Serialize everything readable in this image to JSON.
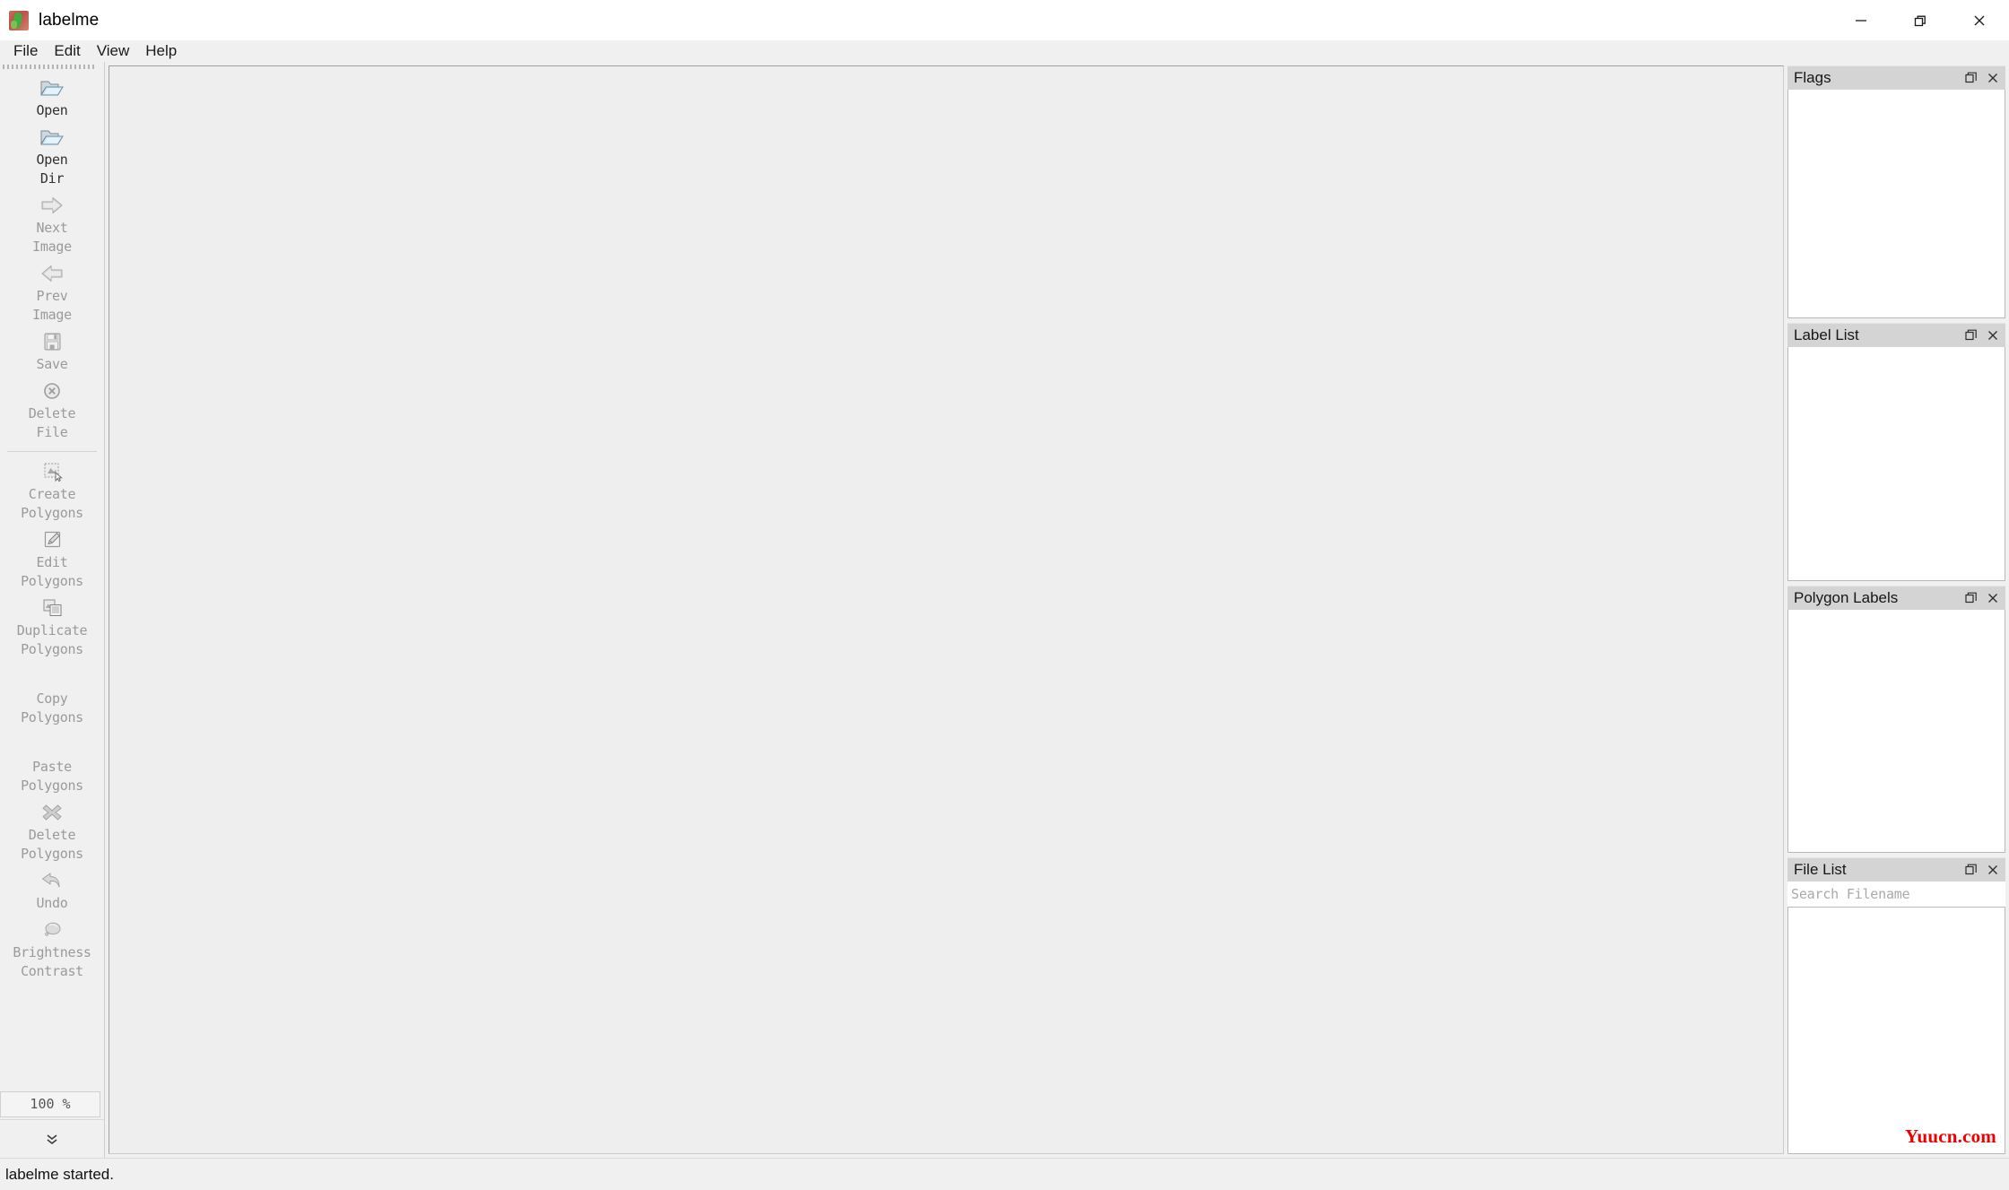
{
  "window": {
    "title": "labelme",
    "icon": "labelme-app-icon",
    "controls": [
      {
        "name": "minimize",
        "glyph": "minimize-icon"
      },
      {
        "name": "restore",
        "glyph": "restore-icon"
      },
      {
        "name": "close",
        "glyph": "close-icon"
      }
    ]
  },
  "menubar": {
    "items": [
      {
        "label": "File"
      },
      {
        "label": "Edit"
      },
      {
        "label": "View"
      },
      {
        "label": "Help"
      }
    ]
  },
  "toolbar": {
    "items": [
      {
        "label": "Open",
        "icon": "open-folder-icon",
        "enabled": true
      },
      {
        "label": "Open\nDir",
        "icon": "open-folder-icon",
        "enabled": true
      },
      {
        "label": "Next\nImage",
        "icon": "arrow-right-icon",
        "enabled": false
      },
      {
        "label": "Prev\nImage",
        "icon": "arrow-left-icon",
        "enabled": false
      },
      {
        "label": "Save",
        "icon": "floppy-save-icon",
        "enabled": false
      },
      {
        "label": "Delete\nFile",
        "icon": "delete-circle-x-icon",
        "enabled": false
      },
      {
        "label": "Create\nPolygons",
        "icon": "create-polygon-icon",
        "enabled": false,
        "separator_before": true
      },
      {
        "label": "Edit\nPolygons",
        "icon": "edit-pencil-icon",
        "enabled": false
      },
      {
        "label": "Duplicate\nPolygons",
        "icon": "duplicate-icon",
        "enabled": false
      },
      {
        "label": "Copy\nPolygons",
        "icon": "copy-icon",
        "enabled": false
      },
      {
        "label": "Paste\nPolygons",
        "icon": "paste-icon",
        "enabled": false
      },
      {
        "label": "Delete\nPolygons",
        "icon": "delete-x-icon",
        "enabled": false
      },
      {
        "label": "Undo",
        "icon": "undo-arrow-icon",
        "enabled": false
      },
      {
        "label": "Brightness\nContrast",
        "icon": "brightness-contrast-icon",
        "enabled": false
      }
    ],
    "zoom_value": "100 %",
    "extend_label": "toolbar-extend-chevron"
  },
  "dock": {
    "panels": [
      {
        "title": "Flags",
        "float_icon": "float-icon",
        "close_icon": "close-icon"
      },
      {
        "title": "Label List",
        "float_icon": "float-icon",
        "close_icon": "close-icon"
      },
      {
        "title": "Polygon Labels",
        "float_icon": "float-icon",
        "close_icon": "close-icon"
      },
      {
        "title": "File List",
        "float_icon": "float-icon",
        "close_icon": "close-icon"
      }
    ],
    "file_search_placeholder": "Search Filename",
    "watermark": "Yuucn.com"
  },
  "statusbar": {
    "message": "labelme started."
  },
  "colors": {
    "window_bg": "#f0f0f0",
    "canvas_bg": "#eeeeee",
    "dock_title_bg": "#d4d4d4",
    "disabled_text": "#9a9a9a",
    "watermark": "#ef0000"
  }
}
